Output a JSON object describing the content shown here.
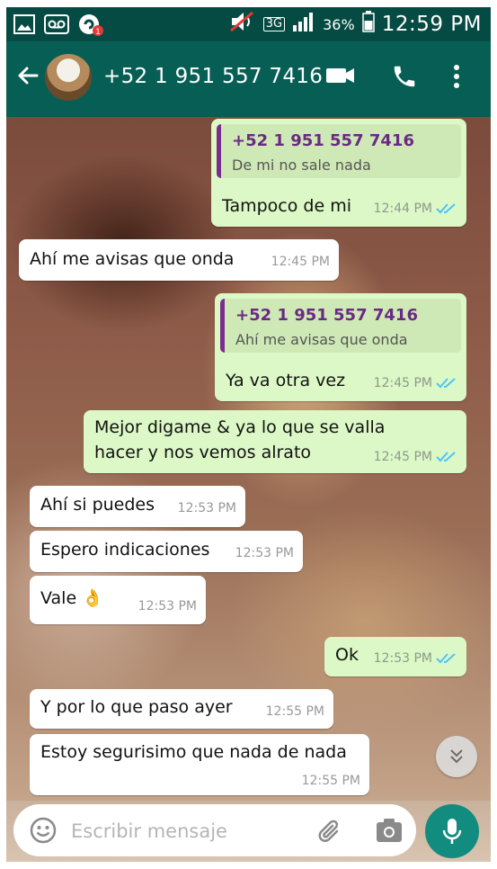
{
  "status_bar": {
    "network": "3G",
    "battery": "36%",
    "time": "12:59 PM"
  },
  "header": {
    "contact": "+52 1 951 557 7416"
  },
  "messages": [
    {
      "dir": "out",
      "quote_name": "+52 1 951 557 7416",
      "quote_text": "De mi no sale nada",
      "text": "Tampoco de mi",
      "time": "12:44 PM"
    },
    {
      "dir": "in",
      "text": "Ahí me avisas que onda",
      "time": "12:45 PM"
    },
    {
      "dir": "out",
      "quote_name": "+52 1 951 557 7416",
      "quote_text": "Ahí me avisas que onda",
      "text": "Ya va otra vez",
      "time": "12:45 PM"
    },
    {
      "dir": "out",
      "line1": "Mejor digame & ya lo que se valla",
      "line2": "hacer y nos vemos alrato",
      "time": "12:45 PM"
    },
    {
      "dir": "in",
      "text": "Ahí si puedes",
      "time": "12:53 PM"
    },
    {
      "dir": "in",
      "text": "Espero indicaciones",
      "time": "12:53 PM"
    },
    {
      "dir": "in",
      "text": "Vale 👌",
      "time": "12:53 PM"
    },
    {
      "dir": "out",
      "text": "Ok",
      "time": "12:53 PM"
    },
    {
      "dir": "in",
      "text": "Y por lo que paso ayer",
      "time": "12:55 PM"
    },
    {
      "dir": "in",
      "text": "Estoy segurisimo que nada de nada",
      "time": "12:55 PM"
    }
  ],
  "input": {
    "placeholder": "Escribir mensaje"
  },
  "colors": {
    "header": "#075e54",
    "status": "#054b43",
    "out_bubble": "#dcf8c6",
    "in_bubble": "#ffffff",
    "read_tick": "#4fc3f7",
    "fab": "#128c7e"
  }
}
